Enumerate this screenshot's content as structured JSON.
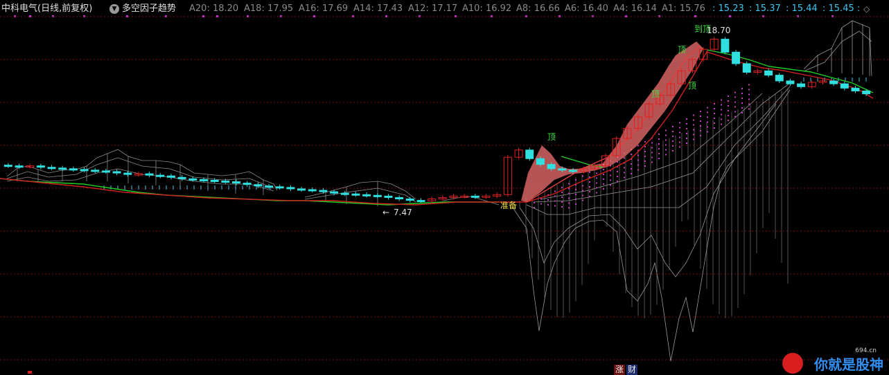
{
  "header": {
    "stock_title": "中科电气(日线,前复权)",
    "indicator_name": "多空因子趋势",
    "ma_grey": [
      {
        "label": "A20",
        "value": "18.20"
      },
      {
        "label": "A18",
        "value": "17.95"
      },
      {
        "label": "A16",
        "value": "17.69"
      },
      {
        "label": "A14",
        "value": "17.43"
      },
      {
        "label": "A12",
        "value": "17.17"
      },
      {
        "label": "A10",
        "value": "16.92"
      },
      {
        "label": "A8",
        "value": "16.66"
      },
      {
        "label": "A6",
        "value": "16.40"
      },
      {
        "label": "A4",
        "value": "16.14"
      },
      {
        "label": "A1",
        "value": "15.76"
      }
    ],
    "ma_blue": [
      "15.23",
      "15.37",
      "15.44",
      "15.45"
    ],
    "colors": {
      "grey": "#8a8a8a",
      "blue": "#3ec5f0"
    }
  },
  "annotations": {
    "peak_label": "到顶",
    "peak_value": "18.70",
    "top_label": "顶",
    "low_value": "7.47",
    "ready_label": "准备"
  },
  "bottom": {
    "badge_rise": "涨",
    "badge_cai": "财"
  },
  "logo": {
    "main": "你就是股神",
    "sub": "694.cn"
  },
  "chart_data": {
    "type": "candlestick",
    "title": "",
    "y_range_hint": [
      7.0,
      19.5
    ],
    "series_close": [
      9.9,
      9.85,
      9.9,
      9.8,
      9.75,
      9.7,
      9.65,
      9.6,
      9.55,
      9.5,
      9.4,
      9.3,
      9.35,
      9.25,
      9.2,
      9.1,
      9.0,
      8.95,
      8.9,
      8.85,
      8.8,
      8.7,
      8.6,
      8.5,
      8.45,
      8.4,
      8.3,
      8.25,
      8.2,
      8.1,
      8.0,
      7.95,
      7.9,
      7.85,
      7.8,
      7.7,
      7.6,
      7.5,
      7.47,
      7.6,
      7.7,
      7.8,
      7.8,
      7.75,
      7.8,
      7.9,
      10.5,
      11.0,
      10.4,
      10.0,
      9.7,
      9.6,
      9.5,
      9.7,
      9.9,
      10.6,
      11.8,
      12.5,
      13.3,
      14.2,
      14.8,
      15.6,
      16.5,
      17.3,
      18.0,
      18.7,
      17.8,
      17.0,
      16.4,
      16.5,
      16.2,
      15.8,
      15.6,
      15.4,
      15.7,
      15.8,
      15.6,
      15.3,
      15.1,
      14.9
    ],
    "annotations": [
      {
        "type": "top",
        "label": "顶"
      },
      {
        "type": "peak",
        "label": "到顶",
        "value": 18.7
      },
      {
        "type": "low",
        "value": 7.47
      },
      {
        "type": "ready",
        "label": "准备"
      }
    ]
  }
}
